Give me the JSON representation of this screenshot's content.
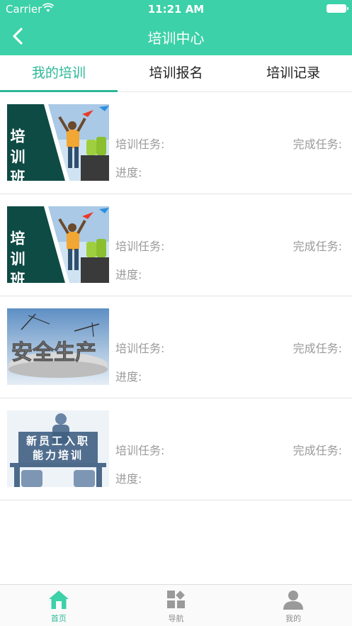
{
  "status_bar": {
    "carrier": "Carrier",
    "time": "11:21 AM"
  },
  "header": {
    "title": "培训中心"
  },
  "tabs": [
    {
      "label": "我的培训",
      "active": true
    },
    {
      "label": "培训报名",
      "active": false
    },
    {
      "label": "培训记录",
      "active": false
    }
  ],
  "items": [
    {
      "image": "training-class-image",
      "image_text": "培训班",
      "task_label": "培训任务:",
      "done_label": "完成任务:",
      "progress_label": "进度:"
    },
    {
      "image": "training-class-image",
      "image_text": "培训班",
      "task_label": "培训任务:",
      "done_label": "完成任务:",
      "progress_label": "进度:"
    },
    {
      "image": "safety-production-image",
      "image_text": "安全生产",
      "task_label": "培训任务:",
      "done_label": "完成任务:",
      "progress_label": "进度:"
    },
    {
      "image": "new-employee-training-image",
      "image_text_line1": "新员工入职",
      "image_text_line2": "能力培训",
      "task_label": "培训任务:",
      "done_label": "完成任务:",
      "progress_label": "进度:"
    }
  ],
  "bottom_nav": [
    {
      "label": "首页",
      "icon": "home-icon",
      "active": true
    },
    {
      "label": "导航",
      "icon": "grid-icon",
      "active": false
    },
    {
      "label": "我的",
      "icon": "user-icon",
      "active": false
    }
  ],
  "colors": {
    "primary": "#3cd1a8",
    "active_text": "#2bb898",
    "label_gray": "#9a9a9a"
  }
}
